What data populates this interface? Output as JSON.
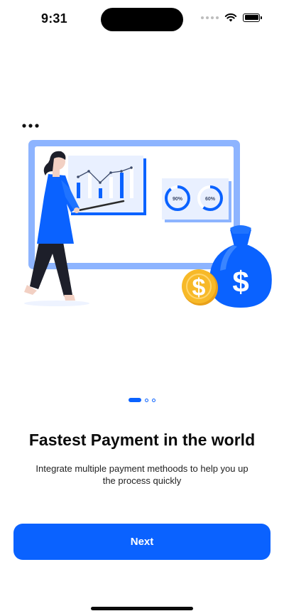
{
  "status_bar": {
    "time": "9:31",
    "icons": [
      "cellular-signal-icon",
      "wifi-icon",
      "battery-icon"
    ]
  },
  "illustration": {
    "icons": [
      "more-dots-icon",
      "presenter-illustration",
      "chart-board",
      "money-bag-icon",
      "coin-icon"
    ],
    "gauge_1_label": "90%",
    "gauge_1_value": 0.9,
    "gauge_2_label": "60%",
    "gauge_2_value": 0.6,
    "accent_color": "#0a62ff",
    "light_color": "#8db4ff"
  },
  "pagination": {
    "active_index": 0,
    "total": 3
  },
  "onboarding": {
    "title": "Fastest Payment in the world",
    "subtitle": "Integrate multiple payment methoods to help you up the process quickly"
  },
  "actions": {
    "next_label": "Next"
  },
  "colors": {
    "primary": "#0a62ff",
    "text": "#0b0b0b",
    "coin": "#f7b928"
  }
}
